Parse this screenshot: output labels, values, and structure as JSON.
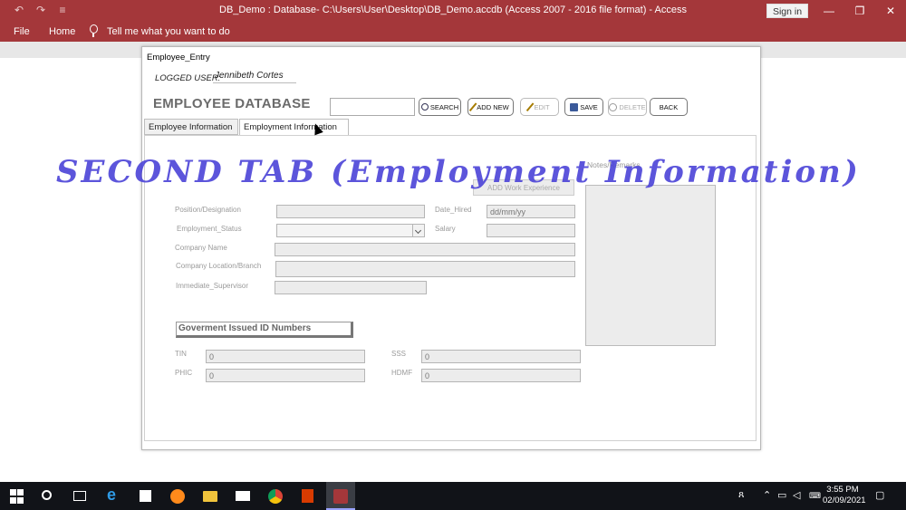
{
  "window": {
    "title": "DB_Demo : Database- C:\\Users\\User\\Desktop\\DB_Demo.accdb (Access 2007 - 2016 file format)  -  Access",
    "sign_in": "Sign in",
    "controls": [
      "—",
      "❐",
      "✕"
    ]
  },
  "quick_access": [
    "↶",
    "↷",
    "≡"
  ],
  "ribbon": {
    "tabs": [
      "File",
      "Home"
    ],
    "tell_me": "Tell me what you want to do"
  },
  "form": {
    "window_title": "Employee_Entry",
    "logged_label": "LOGGED USER:",
    "logged_user": "Jennibeth Cortes",
    "db_title": "EMPLOYEE DATABASE",
    "search_value": "",
    "buttons": {
      "search": "SEARCH",
      "add_new": "ADD NEW",
      "edit": "EDIT",
      "save": "SAVE",
      "delete": "DELETE",
      "back": "BACK"
    },
    "tabs": [
      "Employee Information",
      "Employment Information"
    ],
    "active_tab": "Employment Information",
    "employment": {
      "add_work_experience": "ADD Work Experience",
      "notes_label": "Notes/Remarks",
      "position_label": "Position/Designation",
      "status_label": "Employment_Status",
      "company_label": "Company Name",
      "location_label": "Company Location/Branch",
      "supervisor_label": "Immediate_Supervisor",
      "date_hired_label": "Date_Hired",
      "date_hired_value": "dd/mm/yy",
      "salary_label": "Salary"
    },
    "gov_ids": {
      "heading": "Goverment Issued ID Numbers",
      "tin_label": "TIN",
      "tin_value": "0",
      "phic_label": "PHIC",
      "phic_value": "0",
      "sss_label": "SSS",
      "sss_value": "0",
      "hdmf_label": "HDMF",
      "hdmf_value": "0"
    }
  },
  "overlay_caption": "SECOND TAB  (Employment Information)",
  "taskbar": {
    "time": "3:55 PM",
    "date": "02/09/2021"
  },
  "colors": {
    "access_red": "#a4373a",
    "caption_blue": "#4f47d8",
    "taskbar": "#111318"
  }
}
